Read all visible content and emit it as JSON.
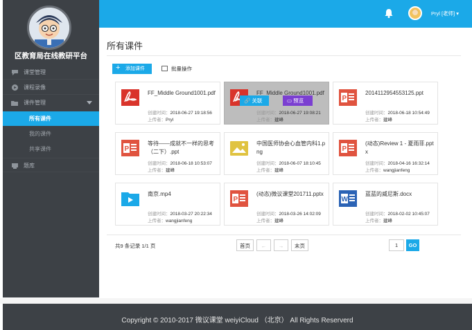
{
  "sidebar": {
    "title": "区教育局在线教研平台",
    "nav": [
      {
        "label": "课堂管理",
        "icon": "chat-icon"
      },
      {
        "label": "课程录像",
        "icon": "record-icon"
      },
      {
        "label": "课件管理",
        "icon": "folder-icon"
      }
    ],
    "subnav": [
      "所有课件",
      "我的课件",
      "共享课件"
    ],
    "library": {
      "label": "题库",
      "icon": "library-icon"
    }
  },
  "header": {
    "user_name": "Pryl [老师] ▾"
  },
  "main": {
    "title": "所有课件",
    "add_label": "添加课件",
    "batch_label": "批量操作",
    "card_actions": {
      "link": "关联",
      "preview": "预览"
    },
    "meta_labels": {
      "created": "创建时间：",
      "uploader": "上传者："
    },
    "cards": [
      {
        "name": "FF_Middle Ground1001.pdf",
        "type": "pdf",
        "created": "2018-06-27 19:18:56",
        "uploader": "Pryl"
      },
      {
        "name": "FF_Middle Ground1001.pdf",
        "type": "pdf",
        "created": "2018-06-27 19:08:21",
        "uploader": "建峰"
      },
      {
        "name": "2014112954553125.ppt",
        "type": "ppt",
        "created": "2018-06-18 10:54:49",
        "uploader": "建峰"
      },
      {
        "name": "等待——成就不一样的思考（二下）.ppt",
        "type": "ppt",
        "created": "2018-06-18 10:53:07",
        "uploader": "建峰"
      },
      {
        "name": "中国医师协会心血管内科1.png",
        "type": "image",
        "created": "2018-06-07 18:10:45",
        "uploader": "建峰"
      },
      {
        "name": "(动态)Review 1 - 夏雨菲.pptx",
        "type": "ppt",
        "created": "2018-04-16 16:32:14",
        "uploader": "wangjianfeng"
      },
      {
        "name": "南京.mp4",
        "type": "video",
        "created": "2018-03-27 20:22:34",
        "uploader": "wangjianfeng"
      },
      {
        "name": "(动态)微议课堂201711.pptx",
        "type": "ppt",
        "created": "2018-03-26 14:02:09",
        "uploader": "建峰"
      },
      {
        "name": "蓝蓝的威尼斯.docx",
        "type": "word",
        "created": "2018-02-02 10:45:07",
        "uploader": "建峰"
      }
    ]
  },
  "pagination": {
    "summary": "共9 条记录 1/1 页",
    "first": "首页",
    "prev": "←",
    "next": "→",
    "last": "末页",
    "page_value": "1",
    "go": "GO"
  },
  "footer": {
    "copyright": "Copyright © 2010-2017 微议课堂 weiyiCloud （北京） All Rights Reserverd"
  },
  "colors": {
    "accent": "#1ba9e8",
    "sidebar_bg": "#3d4146",
    "preview": "#7b3fd1",
    "pdf": "#d9342b",
    "ppt": "#e0533f",
    "word": "#2b63b5",
    "image": "#e0c341",
    "video": "#1ba9e8"
  }
}
